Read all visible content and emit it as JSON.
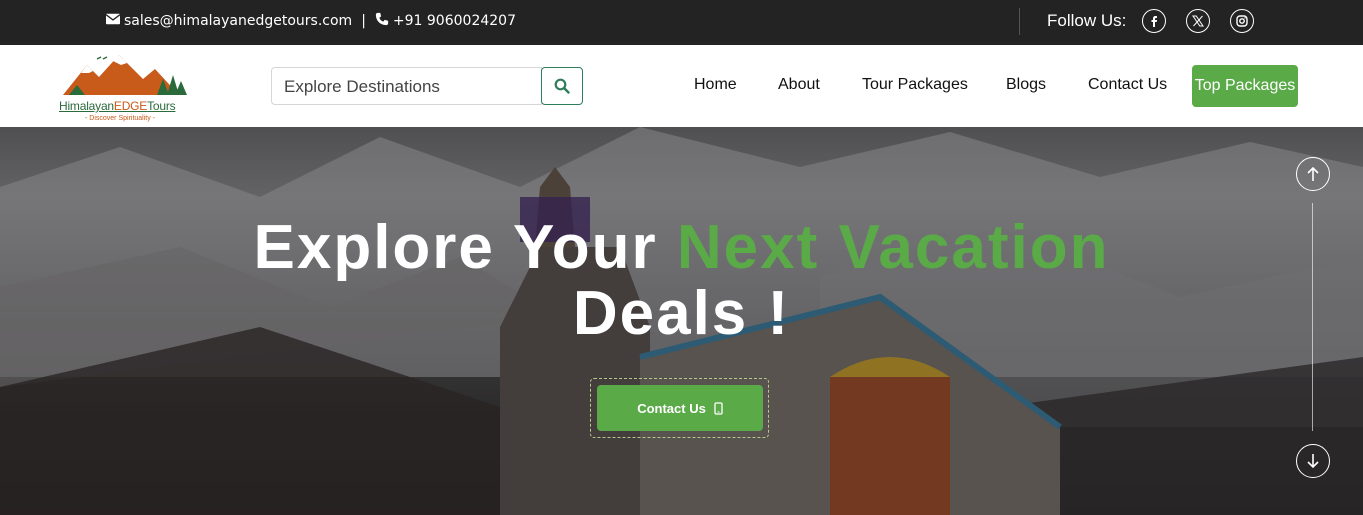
{
  "topbar": {
    "email": "sales@himalayanedgetours.com",
    "separator": "|",
    "phone": "+91 9060024207",
    "follow_label": "Follow Us:"
  },
  "logo": {
    "brand_part1": "Himalayan",
    "brand_part2": "EDGE",
    "brand_part3": "Tours",
    "tagline": "- Discover Spirituality -"
  },
  "search": {
    "placeholder": "Explore Destinations"
  },
  "nav": {
    "items": [
      "Home",
      "About",
      "Tour Packages",
      "Blogs",
      "Contact Us"
    ],
    "cta_label": "Top Packages"
  },
  "hero": {
    "headline_part1": "Explore Your ",
    "headline_highlight": "Next Vacation",
    "headline_part2": "Deals !",
    "cta_label": "Contact Us"
  },
  "colors": {
    "accent_green": "#5aaa48",
    "topbar_bg": "#232323",
    "brand_orange": "#c85a1a"
  }
}
